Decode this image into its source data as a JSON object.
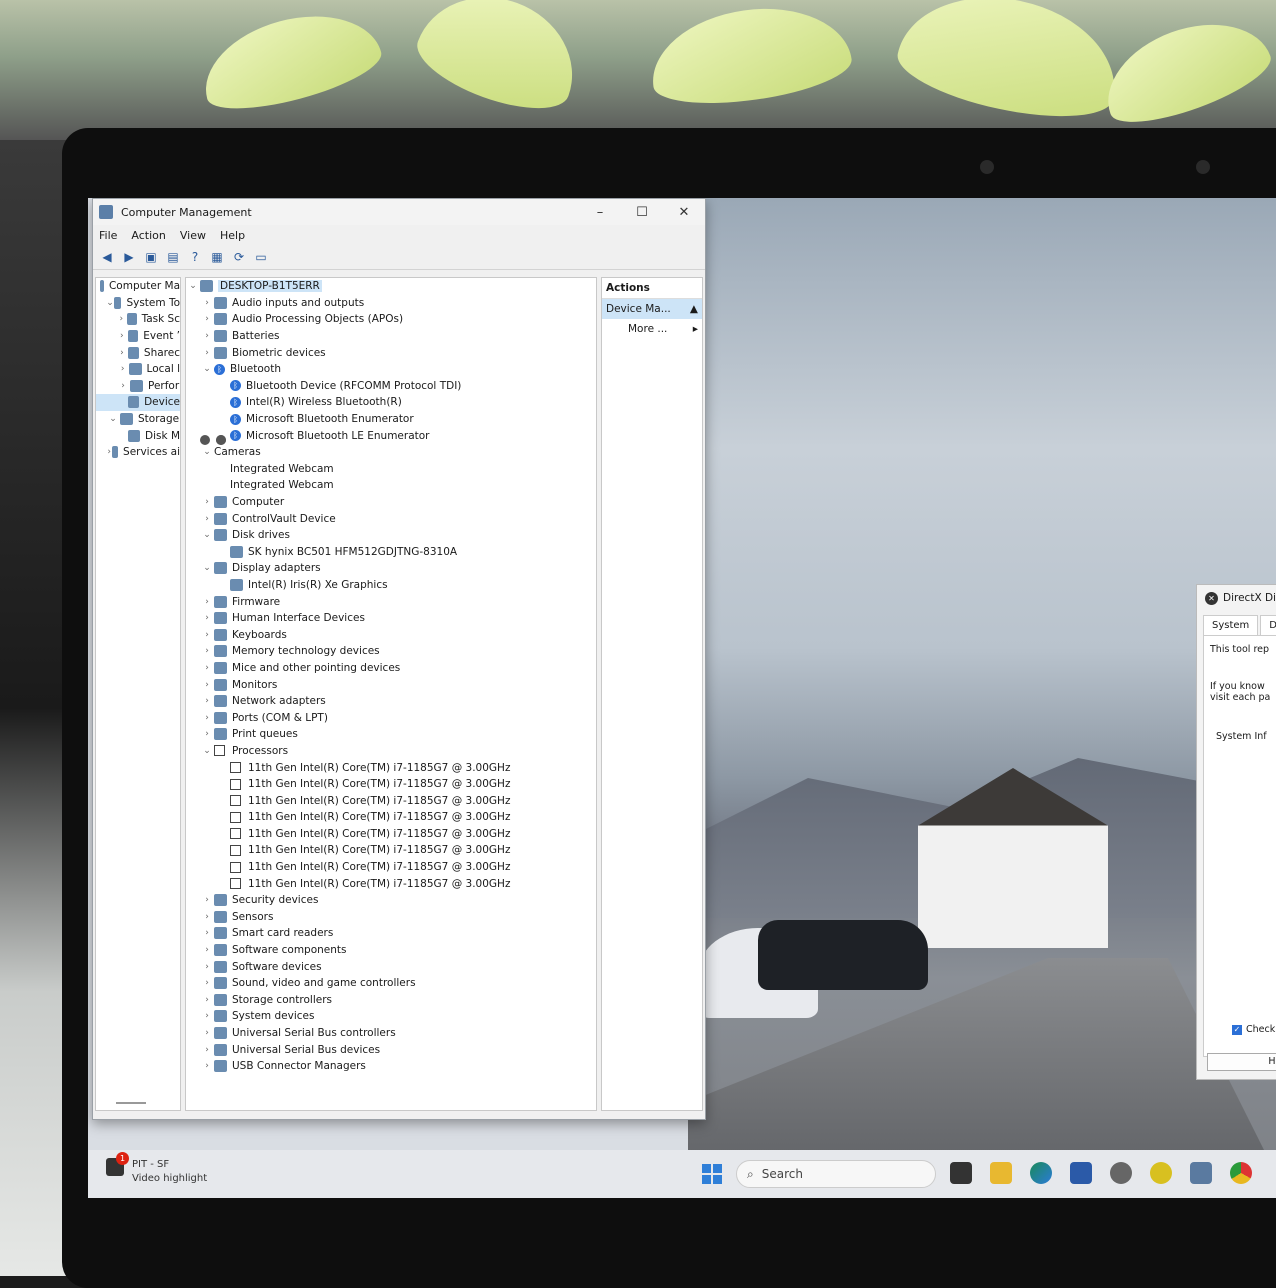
{
  "window": {
    "title": "Computer Management",
    "controls": {
      "minimize": "–",
      "maximize": "☐",
      "close": "✕"
    },
    "menu": [
      "File",
      "Action",
      "View",
      "Help"
    ]
  },
  "tree": {
    "items": [
      {
        "label": "Computer Ma",
        "indent": 0,
        "chev": ""
      },
      {
        "label": "System To",
        "indent": 1,
        "chev": "⌄"
      },
      {
        "label": "Task Sc",
        "indent": 2,
        "chev": "›"
      },
      {
        "label": "Event ’",
        "indent": 2,
        "chev": "›"
      },
      {
        "label": "Sharec",
        "indent": 2,
        "chev": "›"
      },
      {
        "label": "Local l",
        "indent": 2,
        "chev": "›"
      },
      {
        "label": "Perfor",
        "indent": 2,
        "chev": "›"
      },
      {
        "label": "Device",
        "indent": 2,
        "chev": "",
        "selected": true
      },
      {
        "label": "Storage",
        "indent": 1,
        "chev": "⌄"
      },
      {
        "label": "Disk M",
        "indent": 2,
        "chev": ""
      },
      {
        "label": "Services ai",
        "indent": 1,
        "chev": "›"
      }
    ]
  },
  "devices": {
    "root": "DESKTOP-B1T5ERR",
    "rows": [
      {
        "label": "Audio inputs and outputs",
        "chev": "›",
        "level": 1,
        "icon": "speaker"
      },
      {
        "label": "Audio Processing Objects (APOs)",
        "chev": "›",
        "level": 1,
        "icon": "speaker"
      },
      {
        "label": "Batteries",
        "chev": "›",
        "level": 1,
        "icon": "battery"
      },
      {
        "label": "Biometric devices",
        "chev": "›",
        "level": 1,
        "icon": "generic"
      },
      {
        "label": "Bluetooth",
        "chev": "⌄",
        "level": 1,
        "icon": "bluetooth"
      },
      {
        "label": "Bluetooth Device (RFCOMM Protocol TDI)",
        "chev": "",
        "level": 2,
        "icon": "bluetooth"
      },
      {
        "label": "Intel(R) Wireless Bluetooth(R)",
        "chev": "",
        "level": 2,
        "icon": "bluetooth"
      },
      {
        "label": "Microsoft Bluetooth Enumerator",
        "chev": "",
        "level": 2,
        "icon": "bluetooth"
      },
      {
        "label": "Microsoft Bluetooth LE Enumerator",
        "chev": "",
        "level": 2,
        "icon": "bluetooth"
      },
      {
        "label": "Cameras",
        "chev": "⌄",
        "level": 1,
        "icon": "camera"
      },
      {
        "label": "Integrated Webcam",
        "chev": "",
        "level": 2,
        "icon": "camera"
      },
      {
        "label": "Integrated Webcam",
        "chev": "",
        "level": 2,
        "icon": "camera"
      },
      {
        "label": "Computer",
        "chev": "›",
        "level": 1,
        "icon": "monitor"
      },
      {
        "label": "ControlVault Device",
        "chev": "›",
        "level": 1,
        "icon": "generic"
      },
      {
        "label": "Disk drives",
        "chev": "⌄",
        "level": 1,
        "icon": "disk"
      },
      {
        "label": "SK hynix BC501 HFM512GDJTNG-8310A",
        "chev": "",
        "level": 2,
        "icon": "disk"
      },
      {
        "label": "Display adapters",
        "chev": "⌄",
        "level": 1,
        "icon": "monitor"
      },
      {
        "label": "Intel(R) Iris(R) Xe Graphics",
        "chev": "",
        "level": 2,
        "icon": "monitor"
      },
      {
        "label": "Firmware",
        "chev": "›",
        "level": 1,
        "icon": "generic"
      },
      {
        "label": "Human Interface Devices",
        "chev": "›",
        "level": 1,
        "icon": "generic"
      },
      {
        "label": "Keyboards",
        "chev": "›",
        "level": 1,
        "icon": "keyboard"
      },
      {
        "label": "Memory technology devices",
        "chev": "›",
        "level": 1,
        "icon": "generic"
      },
      {
        "label": "Mice and other pointing devices",
        "chev": "›",
        "level": 1,
        "icon": "mouse"
      },
      {
        "label": "Monitors",
        "chev": "›",
        "level": 1,
        "icon": "monitor"
      },
      {
        "label": "Network adapters",
        "chev": "›",
        "level": 1,
        "icon": "network"
      },
      {
        "label": "Ports (COM & LPT)",
        "chev": "›",
        "level": 1,
        "icon": "generic"
      },
      {
        "label": "Print queues",
        "chev": "›",
        "level": 1,
        "icon": "printer"
      },
      {
        "label": "Processors",
        "chev": "⌄",
        "level": 1,
        "icon": "cpu"
      },
      {
        "label": "11th Gen Intel(R) Core(TM) i7-1185G7 @ 3.00GHz",
        "chev": "",
        "level": 2,
        "icon": "cpu"
      },
      {
        "label": "11th Gen Intel(R) Core(TM) i7-1185G7 @ 3.00GHz",
        "chev": "",
        "level": 2,
        "icon": "cpu"
      },
      {
        "label": "11th Gen Intel(R) Core(TM) i7-1185G7 @ 3.00GHz",
        "chev": "",
        "level": 2,
        "icon": "cpu"
      },
      {
        "label": "11th Gen Intel(R) Core(TM) i7-1185G7 @ 3.00GHz",
        "chev": "",
        "level": 2,
        "icon": "cpu"
      },
      {
        "label": "11th Gen Intel(R) Core(TM) i7-1185G7 @ 3.00GHz",
        "chev": "",
        "level": 2,
        "icon": "cpu"
      },
      {
        "label": "11th Gen Intel(R) Core(TM) i7-1185G7 @ 3.00GHz",
        "chev": "",
        "level": 2,
        "icon": "cpu"
      },
      {
        "label": "11th Gen Intel(R) Core(TM) i7-1185G7 @ 3.00GHz",
        "chev": "",
        "level": 2,
        "icon": "cpu"
      },
      {
        "label": "11th Gen Intel(R) Core(TM) i7-1185G7 @ 3.00GHz",
        "chev": "",
        "level": 2,
        "icon": "cpu"
      },
      {
        "label": "Security devices",
        "chev": "›",
        "level": 1,
        "icon": "generic"
      },
      {
        "label": "Sensors",
        "chev": "›",
        "level": 1,
        "icon": "generic"
      },
      {
        "label": "Smart card readers",
        "chev": "›",
        "level": 1,
        "icon": "generic"
      },
      {
        "label": "Software components",
        "chev": "›",
        "level": 1,
        "icon": "generic"
      },
      {
        "label": "Software devices",
        "chev": "›",
        "level": 1,
        "icon": "generic"
      },
      {
        "label": "Sound, video and game controllers",
        "chev": "›",
        "level": 1,
        "icon": "speaker"
      },
      {
        "label": "Storage controllers",
        "chev": "›",
        "level": 1,
        "icon": "generic"
      },
      {
        "label": "System devices",
        "chev": "›",
        "level": 1,
        "icon": "monitor"
      },
      {
        "label": "Universal Serial Bus controllers",
        "chev": "›",
        "level": 1,
        "icon": "usb"
      },
      {
        "label": "Universal Serial Bus devices",
        "chev": "›",
        "level": 1,
        "icon": "usb"
      },
      {
        "label": "USB Connector Managers",
        "chev": "›",
        "level": 1,
        "icon": "usb"
      }
    ]
  },
  "actions": {
    "header": "Actions",
    "selected": "Device Ma...",
    "more": "More ..."
  },
  "directx": {
    "title": "DirectX Di",
    "tabs": [
      "System",
      "Disp"
    ],
    "line1": "This tool rep",
    "line2": "If you know",
    "line3": "visit each pa",
    "line4": "System Inf",
    "check": "Check f",
    "help": "Help"
  },
  "taskbar": {
    "notif_title": "PIT - SF",
    "notif_sub": "Video highlight",
    "notif_badge": "1",
    "search_placeholder": "Search"
  },
  "colors": {
    "accent": "#2f7fd8",
    "selection": "#cde4f7"
  }
}
